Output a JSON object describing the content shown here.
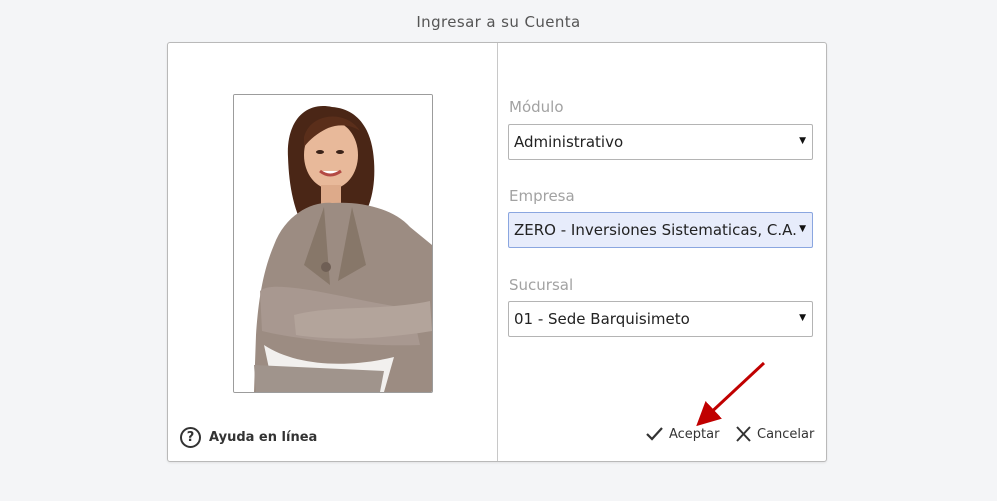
{
  "header": {
    "title": "Ingresar a su Cuenta"
  },
  "photo": {
    "icon": "user-portrait"
  },
  "help": {
    "label": "Ayuda en línea",
    "icon": "question-circle-icon"
  },
  "fields": {
    "modulo": {
      "label": "Módulo",
      "value": "Administrativo"
    },
    "empresa": {
      "label": "Empresa",
      "value": "ZERO - Inversiones Sistematicas, C.A."
    },
    "sucursal": {
      "label": "Sucursal",
      "value": "01 - Sede Barquisimeto"
    }
  },
  "actions": {
    "accept_label": "Aceptar",
    "cancel_label": "Cancelar"
  },
  "colors": {
    "active_select_bg": "#e7ecfb",
    "annotation_arrow": "#c00000"
  }
}
